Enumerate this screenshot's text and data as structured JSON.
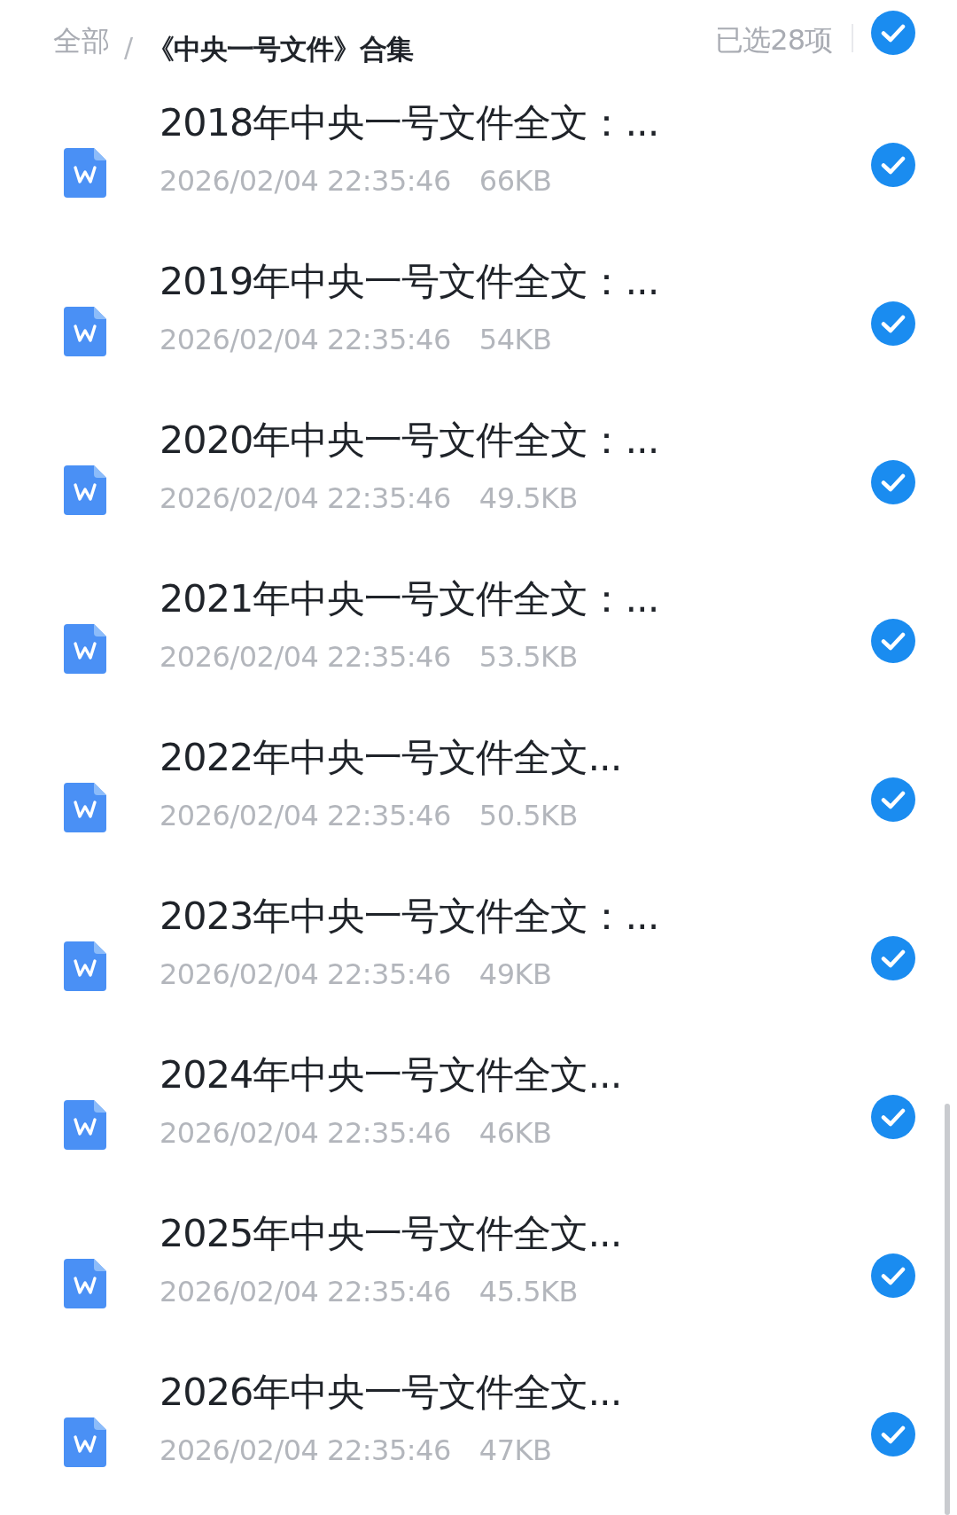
{
  "header": {
    "root": "全部",
    "separator": "/",
    "folder": "《中央一号文件》合集",
    "selection_count": "已选28项",
    "all_selected": true
  },
  "files": [
    {
      "name": "2018年中央一号文件全文：...",
      "modified": "2026/02/04 22:35:46",
      "size": "66KB",
      "selected": true
    },
    {
      "name": "2019年中央一号文件全文：...",
      "modified": "2026/02/04 22:35:46",
      "size": "54KB",
      "selected": true
    },
    {
      "name": "2020年中央一号文件全文：...",
      "modified": "2026/02/04 22:35:46",
      "size": "49.5KB",
      "selected": true
    },
    {
      "name": "2021年中央一号文件全文：...",
      "modified": "2026/02/04 22:35:46",
      "size": "53.5KB",
      "selected": true
    },
    {
      "name": "2022年中央一号文件全文...",
      "modified": "2026/02/04 22:35:46",
      "size": "50.5KB",
      "selected": true
    },
    {
      "name": "2023年中央一号文件全文：...",
      "modified": "2026/02/04 22:35:46",
      "size": "49KB",
      "selected": true
    },
    {
      "name": "2024年中央一号文件全文...",
      "modified": "2026/02/04 22:35:46",
      "size": "46KB",
      "selected": true
    },
    {
      "name": "2025年中央一号文件全文...",
      "modified": "2026/02/04 22:35:46",
      "size": "45.5KB",
      "selected": true
    },
    {
      "name": "2026年中央一号文件全文...",
      "modified": "2026/02/04 22:35:46",
      "size": "47KB",
      "selected": true
    }
  ]
}
